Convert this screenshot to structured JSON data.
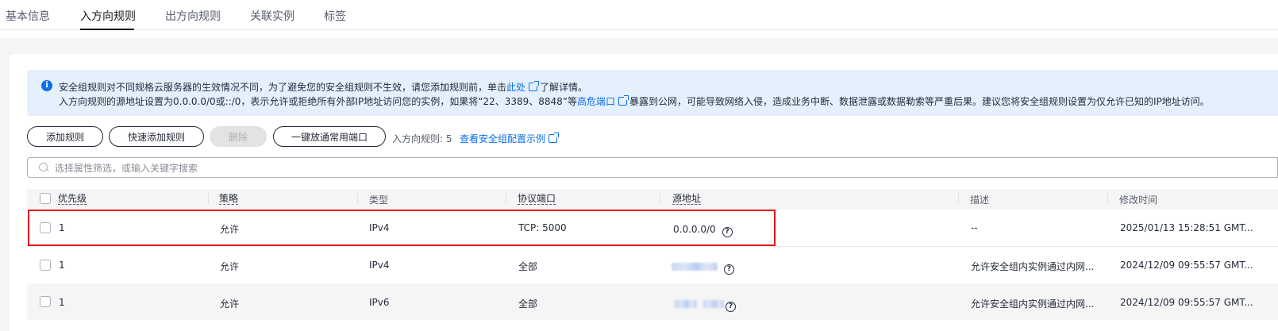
{
  "tabs": [
    "基本信息",
    "入方向规则",
    "出方向规则",
    "关联实例",
    "标签"
  ],
  "alert": {
    "line1_text": "安全组规则对不同规格云服务器的生效情况不同，为了避免您的安全组规则不生效，请您添加规则前，单击",
    "line1_link": "此处",
    "line1_suffix": "了解详情。",
    "line2_text": "入方向规则的源地址设置为0.0.0.0/0或::/0，表示允许或拒绝所有外部IP地址访问您的实例，如果将“22、3389、8848”等",
    "line2_link": "高危端口",
    "line2_suffix": "暴露到公网，可能导致网络入侵，造成业务中断、数据泄露或数据勒索等严重后果。建议您将安全组规则设置为仅允许已知的IP地址访问。"
  },
  "toolbar": {
    "add_rule": "添加规则",
    "quick_add": "快速添加规则",
    "delete": "删除",
    "open_common_ports": "一键放通常用端口",
    "rule_count": "入方向规则: 5",
    "example_link": "查看安全组配置示例"
  },
  "search": {
    "placeholder": "选择属性筛选，或输入关键字搜索"
  },
  "columns": {
    "priority": "优先级",
    "policy": "策略",
    "type": "类型",
    "port": "协议端口",
    "source": "源地址",
    "desc": "描述",
    "modified": "修改时间"
  },
  "rows": [
    {
      "priority": "1",
      "policy": "允许",
      "type": "IPv4",
      "port": "TCP: 5000",
      "source": "0.0.0.0/0",
      "desc": "--",
      "modified": "2025/01/13 15:28:51 GMT..."
    },
    {
      "priority": "1",
      "policy": "允许",
      "type": "IPv4",
      "port": "全部",
      "source": "",
      "desc": "允许安全组内实例通过内网...",
      "modified": "2024/12/09 09:55:57 GMT..."
    },
    {
      "priority": "1",
      "policy": "允许",
      "type": "IPv6",
      "port": "全部",
      "source": "",
      "desc": "允许安全组内实例通过内网...",
      "modified": "2024/12/09 09:55:57 GMT..."
    }
  ],
  "icons": {
    "info": "info-icon",
    "external": "external-link-icon",
    "search": "search-icon",
    "help": "question-mark-icon"
  },
  "colors": {
    "accent": "#0d6ee8",
    "highlight": "#e3141c",
    "alert_bg": "#e6f0fd"
  }
}
